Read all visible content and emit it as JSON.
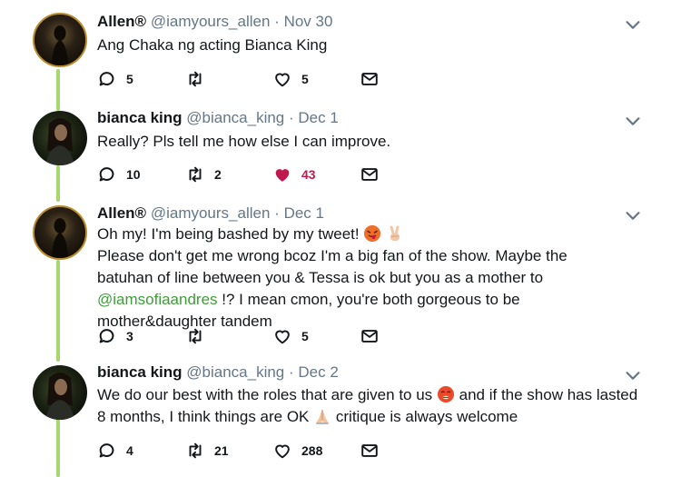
{
  "tweets": [
    {
      "name": "Allen®",
      "handle": "@iamyours_allen",
      "dot": "·",
      "date": "Nov 30",
      "text": "Ang Chaka ng acting Bianca King",
      "replies": "5",
      "retweets": "",
      "likes": "5"
    },
    {
      "name": "bianca king",
      "handle": "@bianca_king",
      "dot": "·",
      "date": "Dec 1",
      "text": "Really? Pls tell me how else I can improve.",
      "replies": "10",
      "retweets": "2",
      "likes": "43"
    },
    {
      "name": "Allen®",
      "handle": "@iamyours_allen",
      "dot": "·",
      "date": "Dec 1",
      "line1": "Oh my! I'm being bashed by my tweet!",
      "line2": "Please don't get me wrong bcoz I'm a big fan of the show. Maybe the batuhan of line between you & Tessa is ok but you as a mother to",
      "mention": "@iamsofiaandres",
      "line3": "!? I mean cmon, you're both gorgeous to be mother&daughter tandem",
      "replies": "3",
      "retweets": "",
      "likes": "5"
    },
    {
      "name": "bianca king",
      "handle": "@bianca_king",
      "dot": "·",
      "date": "Dec 2",
      "part1": "We do our best with the roles that are given to us",
      "part2": "and if the show has lasted 8 months, I think things are OK",
      "part3": "critique is always welcome",
      "replies": "4",
      "retweets": "21",
      "likes": "288"
    }
  ],
  "colors": {
    "thread_line": "#a3d86f",
    "mention": "#3c9e36",
    "liked": "#c0184e",
    "meta": "#657786"
  }
}
